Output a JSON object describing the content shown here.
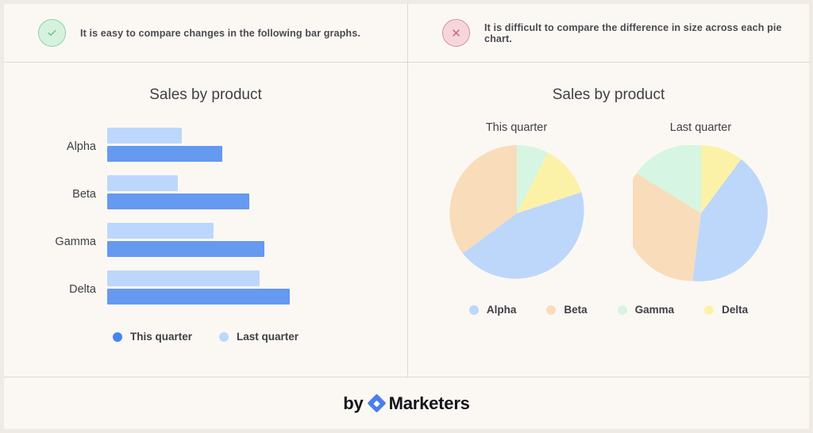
{
  "header": {
    "left": {
      "icon": "check-circle-icon",
      "text": "It is easy to compare changes in the following bar graphs."
    },
    "right": {
      "icon": "x-circle-icon",
      "text": "It is difficult to compare the difference in size across each pie chart."
    }
  },
  "left_panel": {
    "title": "Sales by product",
    "legend": [
      {
        "label": "This quarter",
        "color": "#6699F0"
      },
      {
        "label": "Last quarter",
        "color": "#BDD7FC"
      }
    ]
  },
  "right_panel": {
    "title": "Sales by product",
    "pies": [
      {
        "caption": "This quarter"
      },
      {
        "caption": "Last quarter"
      }
    ],
    "legend": [
      {
        "label": "Alpha",
        "color": "#BDD7FA"
      },
      {
        "label": "Beta",
        "color": "#F9DCB9"
      },
      {
        "label": "Gamma",
        "color": "#D6F5E3"
      },
      {
        "label": "Delta",
        "color": "#FBF2A8"
      }
    ]
  },
  "footer": {
    "by": "by",
    "brand": "Marketers",
    "logo": "diamond-logo-icon"
  },
  "colors": {
    "page_background": "#EFEBE4",
    "card_background": "#FBF8F4",
    "divider": "#DCD7D0",
    "text": "#3F4046",
    "accent_blue": "#4A7DF0"
  },
  "chart_data": [
    {
      "type": "bar",
      "title": "Sales by product",
      "orientation": "horizontal",
      "categories": [
        "Alpha",
        "Beta",
        "Gamma",
        "Delta"
      ],
      "series": [
        {
          "name": "Last quarter",
          "color": "#BDD7FC",
          "values": [
            38,
            36,
            45,
            75
          ]
        },
        {
          "name": "This quarter",
          "color": "#6699F0",
          "values": [
            60,
            75,
            84,
            97
          ]
        }
      ],
      "xlabel": "",
      "ylabel": "",
      "xlim": [
        0,
        100
      ],
      "grid": false,
      "legend_position": "bottom"
    },
    {
      "type": "pie",
      "title": "This quarter",
      "labels": [
        "Gamma",
        "Delta",
        "Alpha",
        "Beta"
      ],
      "values": [
        8,
        22,
        40,
        30
      ],
      "colors": [
        "#D6F5E3",
        "#FBF2A8",
        "#BDD7FA",
        "#F9DCB9"
      ],
      "start_angle_deg": 0,
      "legend_position": "bottom"
    },
    {
      "type": "pie",
      "title": "Last quarter",
      "labels": [
        "Delta",
        "Alpha",
        "Beta",
        "Gamma"
      ],
      "values": [
        10,
        31,
        37,
        22
      ],
      "colors": [
        "#FBF2A8",
        "#BDD7FA",
        "#F9DCB9",
        "#D6F5E3"
      ],
      "start_angle_deg": 0,
      "legend_position": "bottom"
    }
  ]
}
